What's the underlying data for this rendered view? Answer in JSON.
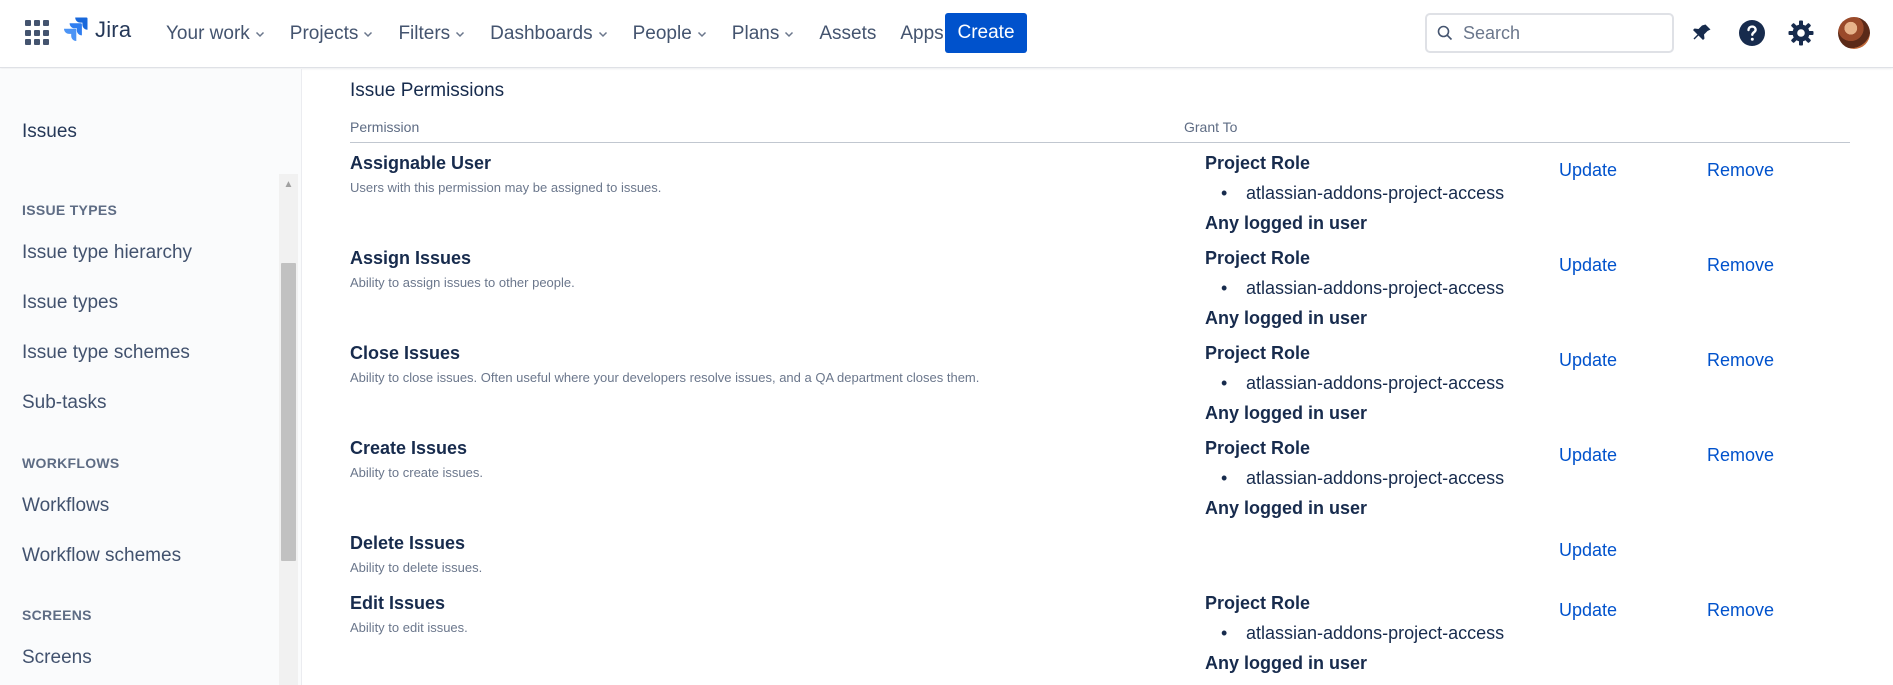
{
  "topnav": {
    "logo_text": "Jira",
    "items": [
      {
        "label": "Your work",
        "has_dropdown": true
      },
      {
        "label": "Projects",
        "has_dropdown": true
      },
      {
        "label": "Filters",
        "has_dropdown": true
      },
      {
        "label": "Dashboards",
        "has_dropdown": true
      },
      {
        "label": "People",
        "has_dropdown": true
      },
      {
        "label": "Plans",
        "has_dropdown": true
      },
      {
        "label": "Assets",
        "has_dropdown": false
      },
      {
        "label": "Apps",
        "has_dropdown": true
      }
    ],
    "create_label": "Create",
    "search_placeholder": "Search",
    "icons": [
      "notifications-icon",
      "help-icon",
      "settings-icon"
    ],
    "accent_color": "#0052cc"
  },
  "sidebar": {
    "heading": "Issues",
    "sections": [
      {
        "title": "ISSUE TYPES",
        "items": [
          "Issue type hierarchy",
          "Issue types",
          "Issue type schemes",
          "Sub-tasks"
        ]
      },
      {
        "title": "WORKFLOWS",
        "items": [
          "Workflows",
          "Workflow schemes"
        ]
      },
      {
        "title": "SCREENS",
        "items": [
          "Screens"
        ]
      }
    ]
  },
  "main": {
    "section_title": "Issue Permissions",
    "columns": {
      "permission": "Permission",
      "grant_to": "Grant To"
    },
    "update_label": "Update",
    "remove_label": "Remove",
    "rows": [
      {
        "name": "Assignable User",
        "description": "Users with this permission may be assigned to issues.",
        "grant_role": "Project Role",
        "grant_role_item": "atlassian-addons-project-access",
        "grant_any": "Any logged in user"
      },
      {
        "name": "Assign Issues",
        "description": "Ability to assign issues to other people.",
        "grant_role": "Project Role",
        "grant_role_item": "atlassian-addons-project-access",
        "grant_any": "Any logged in user"
      },
      {
        "name": "Close Issues",
        "description": "Ability to close issues. Often useful where your developers resolve issues, and a QA department closes them.",
        "grant_role": "Project Role",
        "grant_role_item": "atlassian-addons-project-access",
        "grant_any": "Any logged in user"
      },
      {
        "name": "Create Issues",
        "description": "Ability to create issues.",
        "grant_role": "Project Role",
        "grant_role_item": "atlassian-addons-project-access",
        "grant_any": "Any logged in user"
      },
      {
        "name": "Delete Issues",
        "description": "Ability to delete issues.",
        "grant_role": "",
        "grant_role_item": "",
        "grant_any": ""
      },
      {
        "name": "Edit Issues",
        "description": "Ability to edit issues.",
        "grant_role": "Project Role",
        "grant_role_item": "atlassian-addons-project-access",
        "grant_any": "Any logged in user"
      }
    ]
  }
}
